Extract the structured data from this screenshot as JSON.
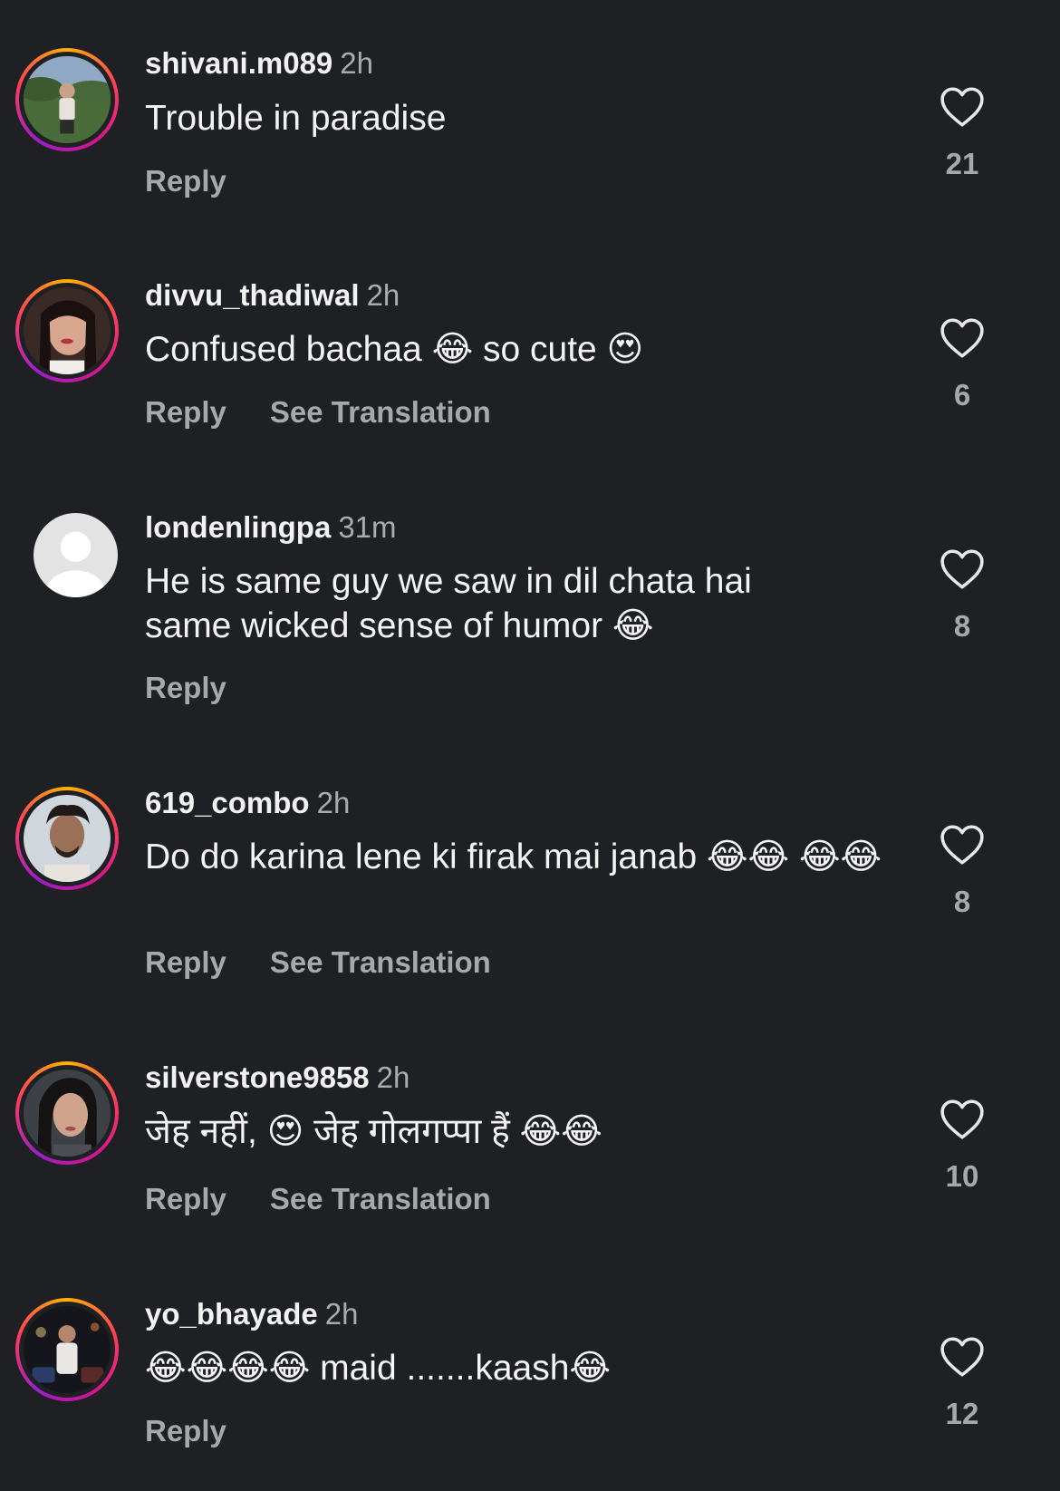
{
  "reply_label": "Reply",
  "see_translation_label": "See Translation",
  "comments": [
    {
      "username": "shivani.m089",
      "time": "2h",
      "text": "Trouble in paradise",
      "likes": "21",
      "avatar": "user-avatar"
    },
    {
      "username": "divvu_thadiwal",
      "time": "2h",
      "text": "Confused bachaa 😂 so cute 😍",
      "likes": "6",
      "avatar": "user-avatar"
    },
    {
      "username": "londenlingpa",
      "time": "31m",
      "text": "He is same guy we saw in dil chata hai same wicked sense of humor 😂",
      "likes": "8",
      "avatar": "default-avatar"
    },
    {
      "username": "619_combo",
      "time": "2h",
      "text": "Do do karina lene ki firak mai janab 😂😂 😂😂",
      "likes": "8",
      "avatar": "user-avatar"
    },
    {
      "username": "silverstone9858",
      "time": "2h",
      "text": "जेह नहीं, 😍 जेह गोलगप्पा हैं 😂😂",
      "likes": "10",
      "avatar": "user-avatar"
    },
    {
      "username": "yo_bhayade",
      "time": "2h",
      "text": "😂😂😂😂 maid .......kaash😂",
      "likes": "12",
      "avatar": "user-avatar"
    }
  ],
  "colors": {
    "background": "#1f2023",
    "secondary_text": "#a6a8ab",
    "story_ring": [
      "#ffb300",
      "#ff3d5a",
      "#d4148f",
      "#9b1fc9"
    ]
  },
  "icons": {
    "like": "heart-outline-icon",
    "default_avatar": "default-avatar-icon"
  }
}
